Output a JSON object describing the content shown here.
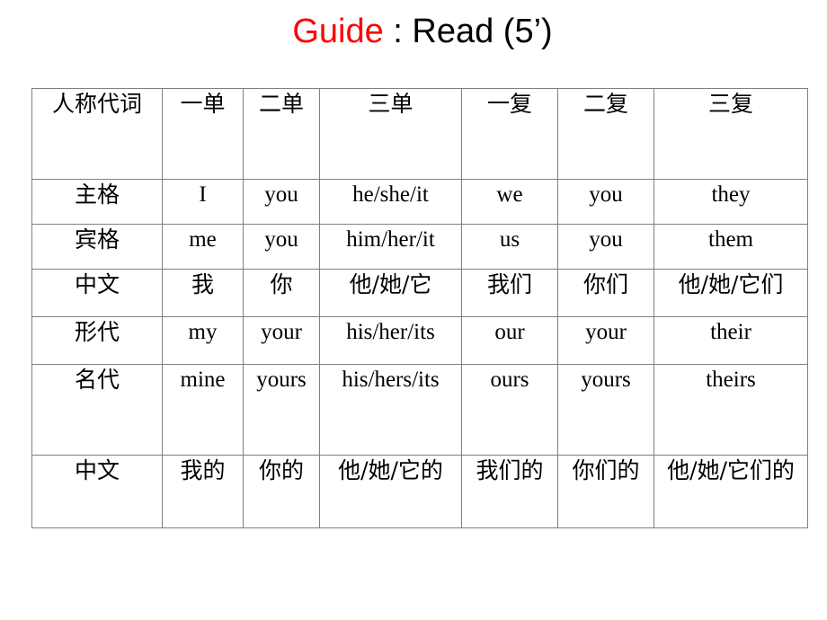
{
  "title": {
    "highlight": "Guide",
    "rest": " : Read (5’)",
    "highlight_color": "#FF0000",
    "rest_color": "#000000"
  },
  "table": {
    "accent_color": "#7030A0",
    "border_color": "#808080",
    "headers": [
      "人称代词",
      "一单",
      "二单",
      "三单",
      "一复",
      "二复",
      "三复"
    ],
    "rows": [
      {
        "label": "主格",
        "style": "en",
        "cells": [
          "I",
          "you",
          "he/she/it",
          "we",
          "you",
          "they"
        ]
      },
      {
        "label": "宾格",
        "style": "en",
        "cells": [
          "me",
          "you",
          "him/her/it",
          "us",
          "you",
          "them"
        ]
      },
      {
        "label": "中文",
        "style": "cn",
        "cells": [
          "我",
          "你",
          "他/她/它",
          "我们",
          "你们",
          "他/她/它们"
        ]
      },
      {
        "label": "形代",
        "style": "en",
        "cells": [
          "my",
          "your",
          "his/her/its",
          "our",
          "your",
          "their"
        ]
      },
      {
        "label": "名代",
        "style": "en",
        "cells": [
          "mine",
          "yours",
          "his/hers/its",
          "ours",
          "yours",
          "theirs"
        ]
      },
      {
        "label": "中文",
        "style": "cn",
        "cells": [
          "我的",
          "你的",
          "他/她/它的",
          "我们的",
          "你们的",
          "他/她/它们的"
        ]
      }
    ]
  }
}
